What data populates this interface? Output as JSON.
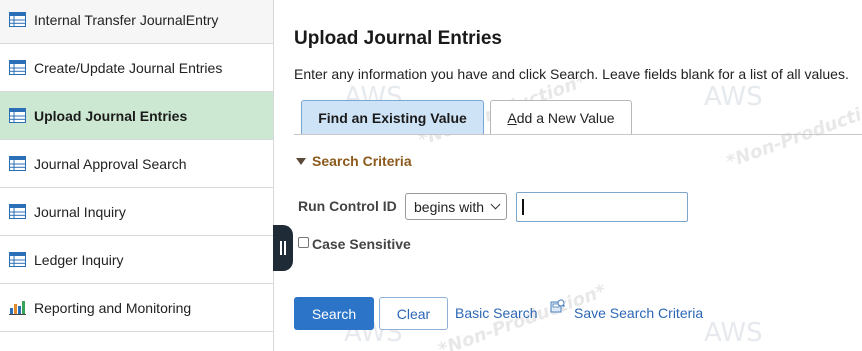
{
  "sidebar": {
    "items": [
      {
        "label": "Internal Transfer JournalEntry",
        "icon": "table-icon"
      },
      {
        "label": "Create/Update Journal Entries",
        "icon": "table-icon"
      },
      {
        "label": "Upload Journal Entries",
        "icon": "table-icon",
        "active": true
      },
      {
        "label": "Journal Approval Search",
        "icon": "table-icon"
      },
      {
        "label": "Journal Inquiry",
        "icon": "table-icon"
      },
      {
        "label": "Ledger Inquiry",
        "icon": "table-icon"
      },
      {
        "label": "Reporting and Monitoring",
        "icon": "bar-chart-icon"
      }
    ],
    "active_color": "#cce8d2"
  },
  "watermark": {
    "brand": "AWS",
    "env": "*Non-Production*"
  },
  "main": {
    "title": "Upload Journal Entries",
    "instructions": "Enter any information you have and click Search. Leave fields blank for a list of all values.",
    "tabs": [
      {
        "label": "Find an Existing Value",
        "selected": true
      },
      {
        "label": "Add a New Value",
        "selected": false
      }
    ],
    "criteria_label": "Search Criteria",
    "run_control": {
      "label": "Run Control ID",
      "operator": "begins with",
      "value": ""
    },
    "case_sensitive": {
      "label": "Case Sensitive",
      "checked": false
    },
    "buttons": {
      "search": "Search",
      "clear": "Clear",
      "basic_search": "Basic Search",
      "save_search": "Save Search Criteria"
    }
  },
  "colors": {
    "primary_button": "#2c74c8",
    "link": "#2c67b5",
    "criteria_heading": "#8b5a1c"
  }
}
